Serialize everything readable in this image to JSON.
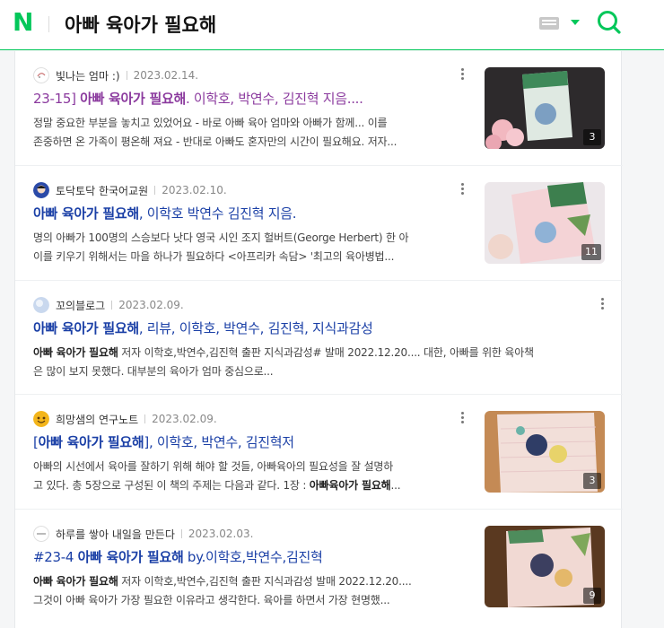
{
  "header": {
    "logo": "N",
    "query": "아빠 육아가 필요해"
  },
  "colors": {
    "brand": "#03c75a",
    "link": "#1a3fa6",
    "visited": "#8b3a9e"
  },
  "results": [
    {
      "source": "빛나는 엄마 :)",
      "date": "2023.02.14.",
      "title_prefix": "23-15] ",
      "title_bold": "아빠 육아가 필요해",
      "title_suffix": ". 이학호, 박연수, 김진혁 지음....",
      "desc_line1": "정말 중요한 부분을 놓치고 있었어요 - 바로 아빠 육아 엄마와 아빠가 함께... 이를",
      "desc_line2": "존중하면 온 가족이 평온해 져요 - 반대로 아빠도 혼자만의 시간이 필요해요. 저자...",
      "image_count": "3"
    },
    {
      "source": "토닥토닥 한국어교원",
      "date": "2023.02.10.",
      "title_prefix": "",
      "title_bold": "아빠 육아가 필요해",
      "title_suffix": ", 이학호 박연수 김진혁 지음.",
      "desc_line1": "명의 아빠가 100명의 스승보다 낫다 영국 시인 조지 헐버트(George Herbert) 한 아",
      "desc_line2": "이를 키우기 위해서는 마을 하나가 필요하다 <아프리카 속담> '최고의 육아병법...",
      "image_count": "11"
    },
    {
      "source": "꼬의블로그",
      "date": "2023.02.09.",
      "title_prefix": "",
      "title_bold": "아빠 육아가 필요해",
      "title_suffix": ", 리뷰, 이학호, 박연수, 김진혁, 지식과감성",
      "desc_bold": "아빠 육아가 필요해",
      "desc_line1": " 저자 이학호,박연수,김진혁 출판 지식과감성# 발매 2022.12.20.... 대한, 아빠를 위한 육아책",
      "desc_line2": "은 많이 보지 못했다. 대부분의 육아가 엄마 중심으로..."
    },
    {
      "source": "희망샘의 연구노트",
      "date": "2023.02.09.",
      "title_prefix": "[",
      "title_bold": "아빠 육아가 필요해",
      "title_suffix": "], 이학호, 박연수, 김진혁저",
      "desc_line1": "아빠의 시선에서 육아를 잘하기 위해 해야 할 것들, 아빠육아의 필요성을 잘 설명하",
      "desc_line2": "고 있다. 총 5장으로 구성된 이 책의 주제는 다음과 같다. 1장 : ",
      "desc_line2_bold": "아빠육아가 필요해",
      "desc_line2_tail": "...",
      "image_count": "3"
    },
    {
      "source": "하루를 쌓아 내일을 만든다",
      "date": "2023.02.03.",
      "title_prefix": "#23-4 ",
      "title_bold": "아빠 육아가 필요해",
      "title_suffix": " by.이학호,박연수,김진혁",
      "desc_bold": "아빠 육아가 필요해",
      "desc_line1": " 저자 이학호,박연수,김진혁 출판 지식과감성 발매 2022.12.20....",
      "desc_line2": "그것이 아빠 육아가 가장 필요한 이유라고 생각한다. 육아를 하면서 가장 현명했...",
      "image_count": "9"
    }
  ]
}
